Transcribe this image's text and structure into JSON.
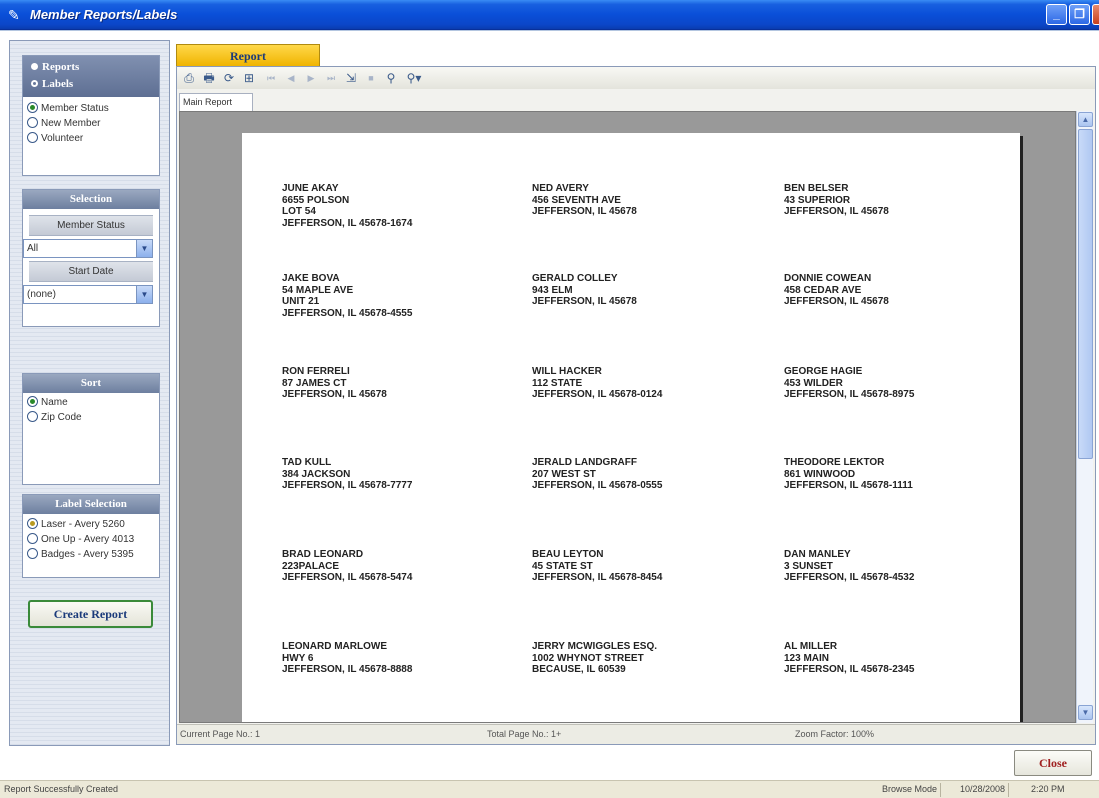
{
  "window": {
    "title": "Member Reports/Labels",
    "min_glyph": "_",
    "max_glyph": "❐",
    "close_glyph": "X"
  },
  "left": {
    "mode_options": [
      {
        "label": "Reports",
        "selected": false
      },
      {
        "label": "Labels",
        "selected": true
      }
    ],
    "report_types": [
      {
        "label": "Member Status",
        "selected": true
      },
      {
        "label": "New Member",
        "selected": false
      },
      {
        "label": "Volunteer",
        "selected": false
      }
    ],
    "selection": {
      "title": "Selection",
      "member_status_label": "Member Status",
      "member_status_value": "All",
      "start_date_label": "Start Date",
      "start_date_value": "(none)"
    },
    "sort": {
      "title": "Sort",
      "options": [
        {
          "label": "Name",
          "selected": true
        },
        {
          "label": "Zip Code",
          "selected": false
        }
      ]
    },
    "label_selection": {
      "title": "Label Selection",
      "options": [
        {
          "label": "Laser - Avery 5260",
          "selected": true
        },
        {
          "label": "One Up - Avery 4013",
          "selected": false
        },
        {
          "label": "Badges - Avery 5395",
          "selected": false
        }
      ]
    },
    "create_button": "Create Report"
  },
  "report_tab": "Report",
  "viewer": {
    "subtab": "Main Report",
    "current_page": "Current Page No.: 1",
    "total_page": "Total Page No.: 1+",
    "zoom": "Zoom Factor: 100%"
  },
  "labels": [
    [
      "JUNE AKAY",
      "6655 POLSON",
      "LOT 54",
      "JEFFERSON, IL  45678-1674"
    ],
    [
      "NED AVERY",
      "456 SEVENTH AVE",
      "JEFFERSON, IL  45678"
    ],
    [
      "BEN BELSER",
      "43 SUPERIOR",
      "JEFFERSON, IL  45678"
    ],
    [
      "JAKE BOVA",
      "54 MAPLE AVE",
      "UNIT 21",
      "JEFFERSON, IL  45678-4555"
    ],
    [
      "GERALD COLLEY",
      "943 ELM",
      "JEFFERSON, IL  45678"
    ],
    [
      "DONNIE COWEAN",
      "458 CEDAR AVE",
      "JEFFERSON, IL  45678"
    ],
    [
      "RON FERRELI",
      "87 JAMES CT",
      "JEFFERSON, IL  45678"
    ],
    [
      "WILL HACKER",
      "112 STATE",
      "JEFFERSON, IL  45678-0124"
    ],
    [
      "GEORGE HAGIE",
      "453 WILDER",
      "JEFFERSON, IL  45678-8975"
    ],
    [
      "TAD KULL",
      "384 JACKSON",
      "JEFFERSON, IL  45678-7777"
    ],
    [
      "JERALD LANDGRAFF",
      "207 WEST ST",
      "JEFFERSON, IL  45678-0555"
    ],
    [
      "THEODORE LEKTOR",
      "861 WINWOOD",
      "JEFFERSON, IL  45678-1111"
    ],
    [
      "BRAD LEONARD",
      "223PALACE",
      "JEFFERSON, IL  45678-5474"
    ],
    [
      "BEAU LEYTON",
      "45 STATE ST",
      "JEFFERSON, IL  45678-8454"
    ],
    [
      "DAN MANLEY",
      "3 SUNSET",
      "JEFFERSON, IL  45678-4532"
    ],
    [
      "LEONARD MARLOWE",
      "HWY 6",
      "JEFFERSON, IL  45678-8888"
    ],
    [
      "JERRY MCWIGGLES ESQ.",
      "1002 WHYNOT STREET",
      "BECAUSE, IL  60539"
    ],
    [
      "AL MILLER",
      "123 MAIN",
      "JEFFERSON, IL  45678-2345"
    ]
  ],
  "close_button": "Close",
  "status": {
    "message": "Report Successfully Created",
    "mode": "Browse Mode",
    "date": "10/28/2008",
    "time": "2:20 PM"
  },
  "icons": [
    "pencil-icon",
    "export-icon",
    "print-icon",
    "refresh-icon",
    "tree-icon",
    "first-page-icon",
    "prev-page-icon",
    "next-page-icon",
    "last-page-icon",
    "goto-page-icon",
    "stop-icon",
    "search-icon",
    "zoom-icon"
  ]
}
